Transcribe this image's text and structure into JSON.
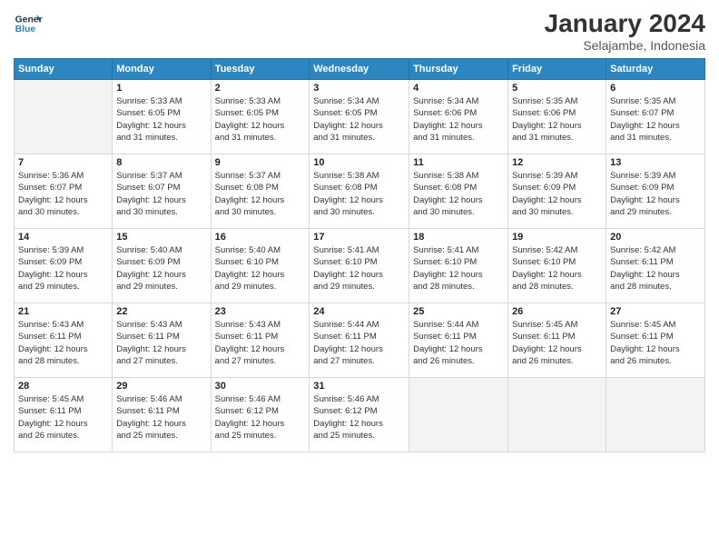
{
  "header": {
    "logo_line1": "General",
    "logo_line2": "Blue",
    "month": "January 2024",
    "location": "Selajambe, Indonesia"
  },
  "days_of_week": [
    "Sunday",
    "Monday",
    "Tuesday",
    "Wednesday",
    "Thursday",
    "Friday",
    "Saturday"
  ],
  "weeks": [
    [
      {
        "day": "",
        "info": ""
      },
      {
        "day": "1",
        "info": "Sunrise: 5:33 AM\nSunset: 6:05 PM\nDaylight: 12 hours\nand 31 minutes."
      },
      {
        "day": "2",
        "info": "Sunrise: 5:33 AM\nSunset: 6:05 PM\nDaylight: 12 hours\nand 31 minutes."
      },
      {
        "day": "3",
        "info": "Sunrise: 5:34 AM\nSunset: 6:05 PM\nDaylight: 12 hours\nand 31 minutes."
      },
      {
        "day": "4",
        "info": "Sunrise: 5:34 AM\nSunset: 6:06 PM\nDaylight: 12 hours\nand 31 minutes."
      },
      {
        "day": "5",
        "info": "Sunrise: 5:35 AM\nSunset: 6:06 PM\nDaylight: 12 hours\nand 31 minutes."
      },
      {
        "day": "6",
        "info": "Sunrise: 5:35 AM\nSunset: 6:07 PM\nDaylight: 12 hours\nand 31 minutes."
      }
    ],
    [
      {
        "day": "7",
        "info": "Sunrise: 5:36 AM\nSunset: 6:07 PM\nDaylight: 12 hours\nand 30 minutes."
      },
      {
        "day": "8",
        "info": "Sunrise: 5:37 AM\nSunset: 6:07 PM\nDaylight: 12 hours\nand 30 minutes."
      },
      {
        "day": "9",
        "info": "Sunrise: 5:37 AM\nSunset: 6:08 PM\nDaylight: 12 hours\nand 30 minutes."
      },
      {
        "day": "10",
        "info": "Sunrise: 5:38 AM\nSunset: 6:08 PM\nDaylight: 12 hours\nand 30 minutes."
      },
      {
        "day": "11",
        "info": "Sunrise: 5:38 AM\nSunset: 6:08 PM\nDaylight: 12 hours\nand 30 minutes."
      },
      {
        "day": "12",
        "info": "Sunrise: 5:39 AM\nSunset: 6:09 PM\nDaylight: 12 hours\nand 30 minutes."
      },
      {
        "day": "13",
        "info": "Sunrise: 5:39 AM\nSunset: 6:09 PM\nDaylight: 12 hours\nand 29 minutes."
      }
    ],
    [
      {
        "day": "14",
        "info": "Sunrise: 5:39 AM\nSunset: 6:09 PM\nDaylight: 12 hours\nand 29 minutes."
      },
      {
        "day": "15",
        "info": "Sunrise: 5:40 AM\nSunset: 6:09 PM\nDaylight: 12 hours\nand 29 minutes."
      },
      {
        "day": "16",
        "info": "Sunrise: 5:40 AM\nSunset: 6:10 PM\nDaylight: 12 hours\nand 29 minutes."
      },
      {
        "day": "17",
        "info": "Sunrise: 5:41 AM\nSunset: 6:10 PM\nDaylight: 12 hours\nand 29 minutes."
      },
      {
        "day": "18",
        "info": "Sunrise: 5:41 AM\nSunset: 6:10 PM\nDaylight: 12 hours\nand 28 minutes."
      },
      {
        "day": "19",
        "info": "Sunrise: 5:42 AM\nSunset: 6:10 PM\nDaylight: 12 hours\nand 28 minutes."
      },
      {
        "day": "20",
        "info": "Sunrise: 5:42 AM\nSunset: 6:11 PM\nDaylight: 12 hours\nand 28 minutes."
      }
    ],
    [
      {
        "day": "21",
        "info": "Sunrise: 5:43 AM\nSunset: 6:11 PM\nDaylight: 12 hours\nand 28 minutes."
      },
      {
        "day": "22",
        "info": "Sunrise: 5:43 AM\nSunset: 6:11 PM\nDaylight: 12 hours\nand 27 minutes."
      },
      {
        "day": "23",
        "info": "Sunrise: 5:43 AM\nSunset: 6:11 PM\nDaylight: 12 hours\nand 27 minutes."
      },
      {
        "day": "24",
        "info": "Sunrise: 5:44 AM\nSunset: 6:11 PM\nDaylight: 12 hours\nand 27 minutes."
      },
      {
        "day": "25",
        "info": "Sunrise: 5:44 AM\nSunset: 6:11 PM\nDaylight: 12 hours\nand 26 minutes."
      },
      {
        "day": "26",
        "info": "Sunrise: 5:45 AM\nSunset: 6:11 PM\nDaylight: 12 hours\nand 26 minutes."
      },
      {
        "day": "27",
        "info": "Sunrise: 5:45 AM\nSunset: 6:11 PM\nDaylight: 12 hours\nand 26 minutes."
      }
    ],
    [
      {
        "day": "28",
        "info": "Sunrise: 5:45 AM\nSunset: 6:11 PM\nDaylight: 12 hours\nand 26 minutes."
      },
      {
        "day": "29",
        "info": "Sunrise: 5:46 AM\nSunset: 6:11 PM\nDaylight: 12 hours\nand 25 minutes."
      },
      {
        "day": "30",
        "info": "Sunrise: 5:46 AM\nSunset: 6:12 PM\nDaylight: 12 hours\nand 25 minutes."
      },
      {
        "day": "31",
        "info": "Sunrise: 5:46 AM\nSunset: 6:12 PM\nDaylight: 12 hours\nand 25 minutes."
      },
      {
        "day": "",
        "info": ""
      },
      {
        "day": "",
        "info": ""
      },
      {
        "day": "",
        "info": ""
      }
    ]
  ]
}
